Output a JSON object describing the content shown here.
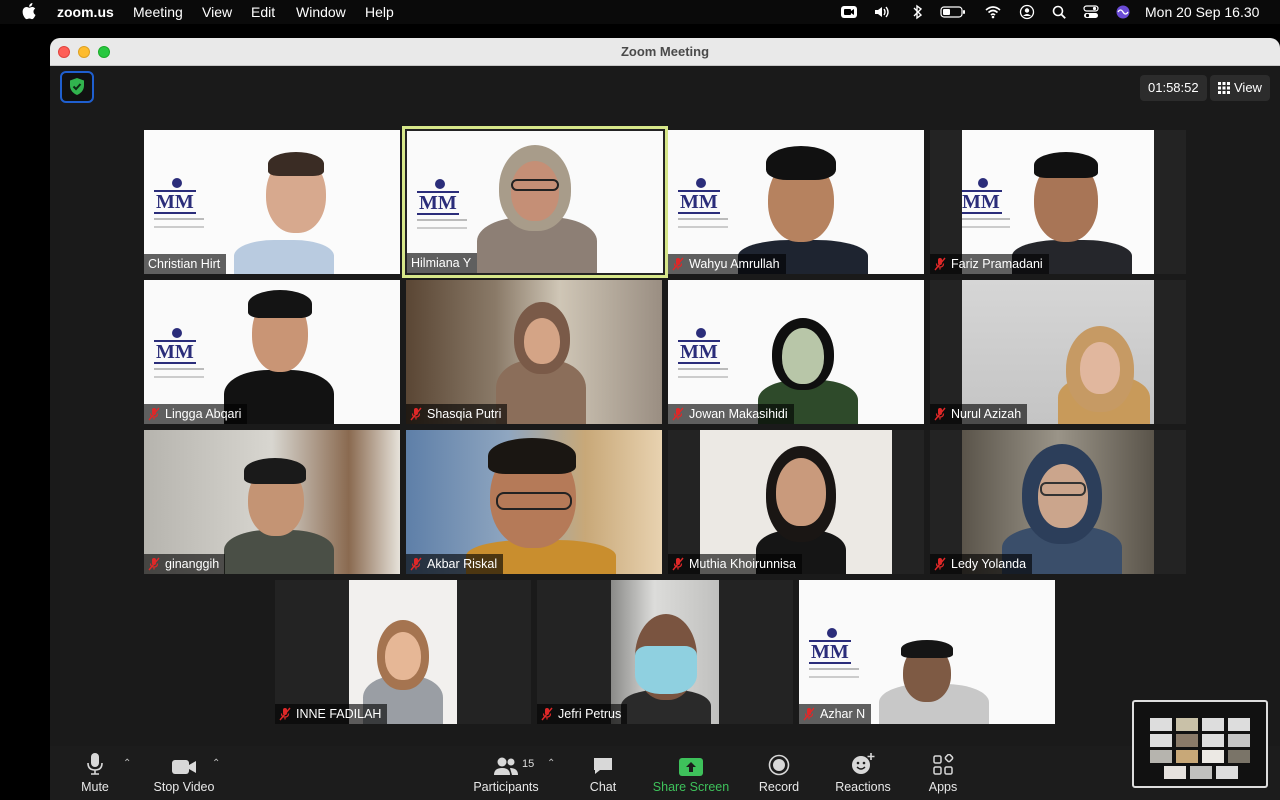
{
  "menubar": {
    "app": "zoom.us",
    "items": [
      "Meeting",
      "View",
      "Edit",
      "Window",
      "Help"
    ],
    "datetime": "Mon 20 Sep  16.30"
  },
  "window": {
    "title": "Zoom Meeting",
    "timer": "01:58:52",
    "view_label": "View"
  },
  "participants": [
    {
      "name": "Christian Hirt",
      "muted": false
    },
    {
      "name": "Hilmiana Y",
      "muted": false,
      "active": true
    },
    {
      "name": "Wahyu Amrullah",
      "muted": true
    },
    {
      "name": "Fariz Pramadani",
      "muted": true
    },
    {
      "name": "Lingga Abqari",
      "muted": true
    },
    {
      "name": "Shasqia Putri",
      "muted": true
    },
    {
      "name": "Jowan Makasihidi",
      "muted": true
    },
    {
      "name": "Nurul Azizah",
      "muted": true
    },
    {
      "name": "ginanggih",
      "muted": true
    },
    {
      "name": "Akbar Riskal",
      "muted": true
    },
    {
      "name": "Muthia Khoirunnisa",
      "muted": true
    },
    {
      "name": "Ledy Yolanda",
      "muted": true
    },
    {
      "name": "INNE FADILAH",
      "muted": true
    },
    {
      "name": "Jefri Petrus",
      "muted": true
    },
    {
      "name": "Azhar N",
      "muted": true
    }
  ],
  "toolbar": {
    "mute": "Mute",
    "stop_video": "Stop Video",
    "participants": "Participants",
    "participants_count": "15",
    "chat": "Chat",
    "share_screen": "Share Screen",
    "record": "Record",
    "reactions": "Reactions",
    "apps": "Apps"
  },
  "colors": {
    "active_speaker": "#d7e78a",
    "share_green": "#3ec15b",
    "shield_blue": "#1f5fcf"
  }
}
